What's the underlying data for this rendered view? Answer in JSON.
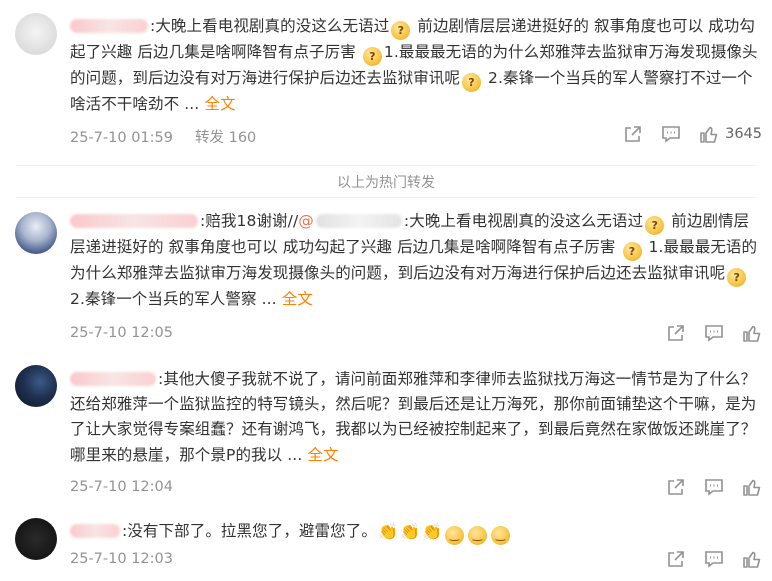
{
  "comments": [
    {
      "username": "用户昵称",
      "segments": [
        ":大晚上看电视剧真的没这么无语过",
        " 前边剧情层层递进挺好的 叙事角度也可以 成功勾起了兴趣 后边几集是啥啊降智有点子厉害 ",
        "1.最最最无语的为什么郑雅萍去监狱审万海发现摄像头的问题，到后边没有对万海进行保护后边还去监狱审讯呢",
        " 2.秦锋一个当兵的军人警察打不过一个啥活不干啥劲不 ... "
      ],
      "more_label": "全文",
      "time": "25-7-10 01:59",
      "repost_label": "转发 160",
      "likes": "3645"
    },
    {
      "username": "用户昵称",
      "text_a": ":赔我18谢谢//",
      "mention": "@用户昵称",
      "segments": [
        ":大晚上看电视剧真的没这么无语过",
        " 前边剧情层层递进挺好的 叙事角度也可以 成功勾起了兴趣 后边几集是啥啊降智有点子厉害 ",
        " 1.最最最无语的为什么郑雅萍去监狱审万海发现摄像头的问题，到后边没有对万海进行保护后边还去监狱审讯呢",
        " 2.秦锋一个当兵的军人警察 ... "
      ],
      "more_label": "全文",
      "time": "25-7-10 12:05"
    },
    {
      "username": "用户昵称",
      "segments": [
        ":其他大傻子我就不说了，请问前面郑雅萍和李律师去监狱找万海这一情节是为了什么？还给郑雅萍一个监狱监控的特写镜头，然后呢？到最后还是让万海死，那你前面铺垫这个干嘛，是为了让大家觉得专案组蠢？还有谢鸿飞，我都以为已经被控制起来了，到最后竟然在家做饭还跳崖了？哪里来的悬崖，那个景P的我以 ... "
      ],
      "more_label": "全文",
      "time": "25-7-10 12:04"
    },
    {
      "username": "用户昵称",
      "segments": [
        ":没有下部了。拉黑您了，避雷您了。"
      ],
      "time": "25-7-10 12:03"
    }
  ],
  "separator_label": "以上为热门转发",
  "icons": [
    "share-icon",
    "comment-icon",
    "like-icon",
    "emoji-icon",
    "clap-emoji-icon",
    "smile-emoji-icon"
  ],
  "colors": {
    "link": "#ff8200",
    "mention": "#eb7350",
    "meta": "#939393",
    "text": "#333333"
  }
}
